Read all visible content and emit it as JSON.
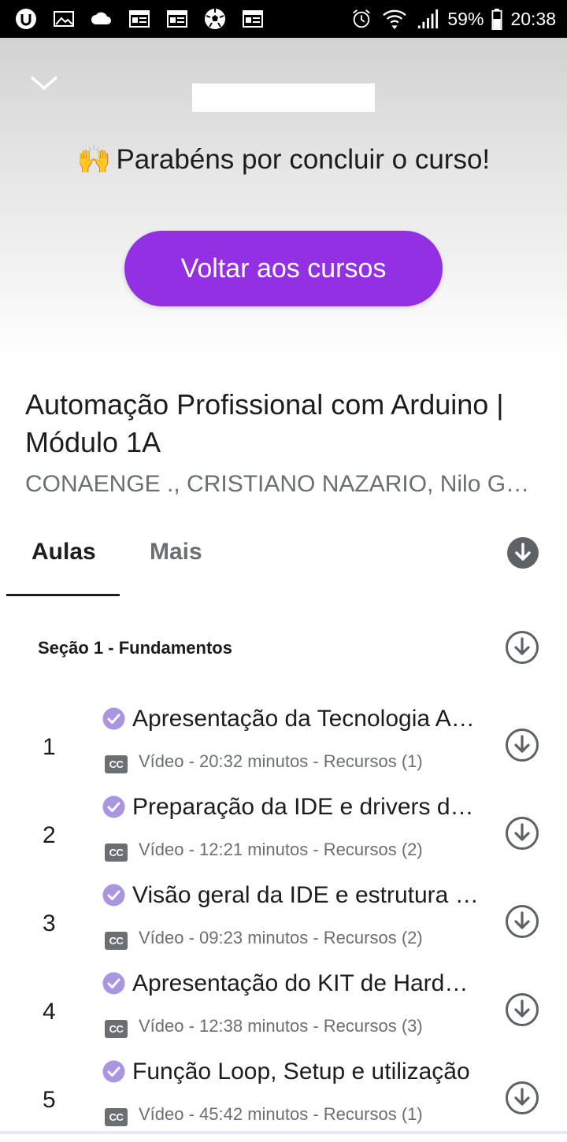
{
  "status_bar": {
    "left_icons": [
      "udemy-icon",
      "image-icon",
      "cloud-icon",
      "news-icon",
      "news-icon",
      "soccer-ball-icon",
      "news-icon"
    ],
    "battery": "59%",
    "time": "20:38"
  },
  "header": {
    "congrats_emoji": "🙌",
    "congrats_text": "Parabéns por concluir o curso!",
    "back_button": "Voltar aos cursos"
  },
  "course": {
    "title": "Automação Profissional com Arduino | Módulo 1A",
    "instructors": "CONAENGE ., CRISTIANO NAZARIO, Nilo Guimarães"
  },
  "tabs": [
    {
      "label": "Aulas",
      "active": true
    },
    {
      "label": "Mais",
      "active": false
    }
  ],
  "section": {
    "title": "Seção 1 - Fundamentos"
  },
  "lectures": [
    {
      "number": "1",
      "title": "Apresentação da Tecnologia Arduino",
      "meta": "Vídeo - 20:32 minutos - Recursos (1)"
    },
    {
      "number": "2",
      "title": "Preparação da IDE e drivers de instalação",
      "meta": "Vídeo - 12:21 minutos - Recursos (2)"
    },
    {
      "number": "3",
      "title": "Visão geral da IDE e estrutura do código",
      "meta": "Vídeo - 09:23 minutos - Recursos (2)"
    },
    {
      "number": "4",
      "title": "Apresentação do KIT de Hardware",
      "meta": "Vídeo - 12:38 minutos - Recursos (3)"
    },
    {
      "number": "5",
      "title": "Função Loop, Setup e utilização",
      "meta": "Vídeo - 45:42 minutos - Recursos (1)"
    }
  ],
  "colors": {
    "accent": "#9330e3",
    "check": "#a995e0",
    "muted_text": "#6a6f73",
    "icon_gray": "#5d6267"
  },
  "cc_label": "CC"
}
